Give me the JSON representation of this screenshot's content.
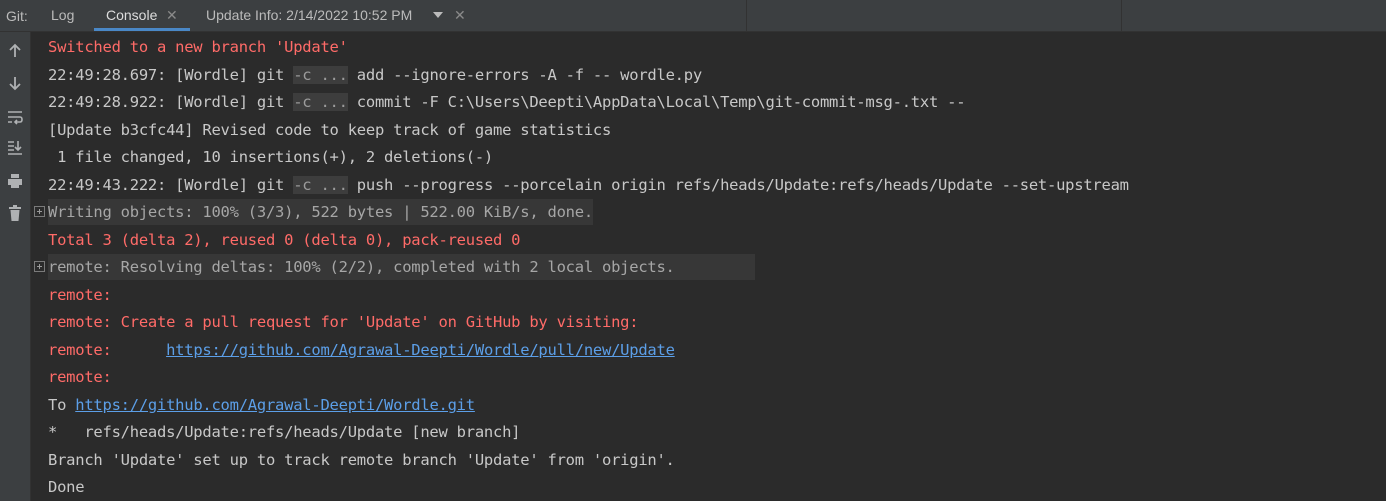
{
  "tabbar": {
    "tool_label": "Git:",
    "tabs": [
      {
        "label": "Log"
      },
      {
        "label": "Console"
      },
      {
        "label": "Update Info: 2/14/2022 10:52 PM"
      }
    ],
    "close_glyph": "✕"
  },
  "toolbar": {
    "icons": [
      "up-arrow-icon",
      "down-arrow-icon",
      "soft-wrap-icon",
      "scroll-to-end-icon",
      "print-icon",
      "trash-icon"
    ]
  },
  "console": {
    "lines": [
      {
        "text": "Switched to a new branch 'Update'"
      },
      {
        "prefix": "22:49:28.697: [Wordle] git ",
        "ellipsis": "-c ...",
        "suffix": " add --ignore-errors -A -f -- wordle.py"
      },
      {
        "prefix": "22:49:28.922: [Wordle] git ",
        "ellipsis": "-c ...",
        "suffix": " commit -F C:\\Users\\Deepti\\AppData\\Local\\Temp\\git-commit-msg-.txt --"
      },
      {
        "text": "[Update b3cfc44] Revised code to keep track of game statistics"
      },
      {
        "text": " 1 file changed, 10 insertions(+), 2 deletions(-)"
      },
      {
        "prefix": "22:49:43.222: [Wordle] git ",
        "ellipsis": "-c ...",
        "suffix": " push --progress --porcelain origin refs/heads/Update:refs/heads/Update --set-upstream"
      },
      {
        "text": "Writing objects: 100% (3/3), 522 bytes | 522.00 KiB/s, done."
      },
      {
        "text": "Total 3 (delta 2), reused 0 (delta 0), pack-reused 0"
      },
      {
        "text": "remote: Resolving deltas: 100% (2/2), completed with 2 local objects."
      },
      {
        "text": "remote:"
      },
      {
        "text": "remote: Create a pull request for 'Update' on GitHub by visiting:"
      },
      {
        "prefix": "remote:      ",
        "link": "https://github.com/Agrawal-Deepti/Wordle/pull/new/Update"
      },
      {
        "text": "remote:"
      },
      {
        "prefix": "To ",
        "link": "https://github.com/Agrawal-Deepti/Wordle.git"
      },
      {
        "text": "*   refs/heads/Update:refs/heads/Update [new branch]"
      },
      {
        "text": "Branch 'Update' set up to track remote branch 'Update' from 'origin'."
      },
      {
        "text": "Done"
      }
    ]
  },
  "colors": {
    "error_text": "#ff6b68",
    "normal_text": "#c8c8c8",
    "link": "#5c9fe8",
    "accent_underline": "#4a88c7"
  }
}
